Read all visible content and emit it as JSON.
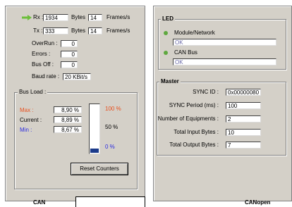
{
  "canbus": {
    "rx_label": "Rx :",
    "rx_value": "1934",
    "rx_bytes_label": "Bytes",
    "rx_bytes_value": "14",
    "rx_frames_label": "Frames/s",
    "tx_label": "Tx :",
    "tx_value": "333",
    "tx_bytes_label": "Bytes",
    "tx_bytes_value": "14",
    "tx_frames_label": "Frames/s",
    "overrun_label": "OverRun :",
    "overrun_value": "0",
    "errors_label": "Errors :",
    "errors_value": "0",
    "busoff_label": "Bus Off :",
    "busoff_value": "0",
    "baud_label": "Baud rate :",
    "baud_value": "20 KBit/s",
    "busload": {
      "title": "Bus Load :",
      "max_label": "Max :",
      "max_value": "8,90 %",
      "current_label": "Current :",
      "current_value": "8,89 %",
      "min_label": "Min :",
      "min_value": "8,67 %",
      "scale_top": "100 %",
      "scale_mid": "50 %",
      "scale_bottom": "0 %",
      "level_fraction": 0.089,
      "max_color": "#e8501e",
      "min_color": "#2a2ae0",
      "bar_color": "#1b3a8a"
    },
    "reset_label": "Reset Counters",
    "tab_label": "CAN"
  },
  "canopen": {
    "led_title": "LED",
    "module_label": "Module/Network",
    "module_status": "OK",
    "canbus_label": "CAN Bus",
    "canbus_status": "OK",
    "led_color": "#5fa83f",
    "master_title": "Master",
    "sync_id_label": "SYNC ID :",
    "sync_id_value": "0x00000080",
    "sync_period_label": "SYNC Period (ms) :",
    "sync_period_value": "100",
    "num_equipments_label": "Number of Equipments :",
    "num_equipments_value": "2",
    "total_input_label": "Total Input Bytes :",
    "total_input_value": "10",
    "total_output_label": "Total Output Bytes :",
    "total_output_value": "7",
    "tab_label": "CANopen"
  }
}
